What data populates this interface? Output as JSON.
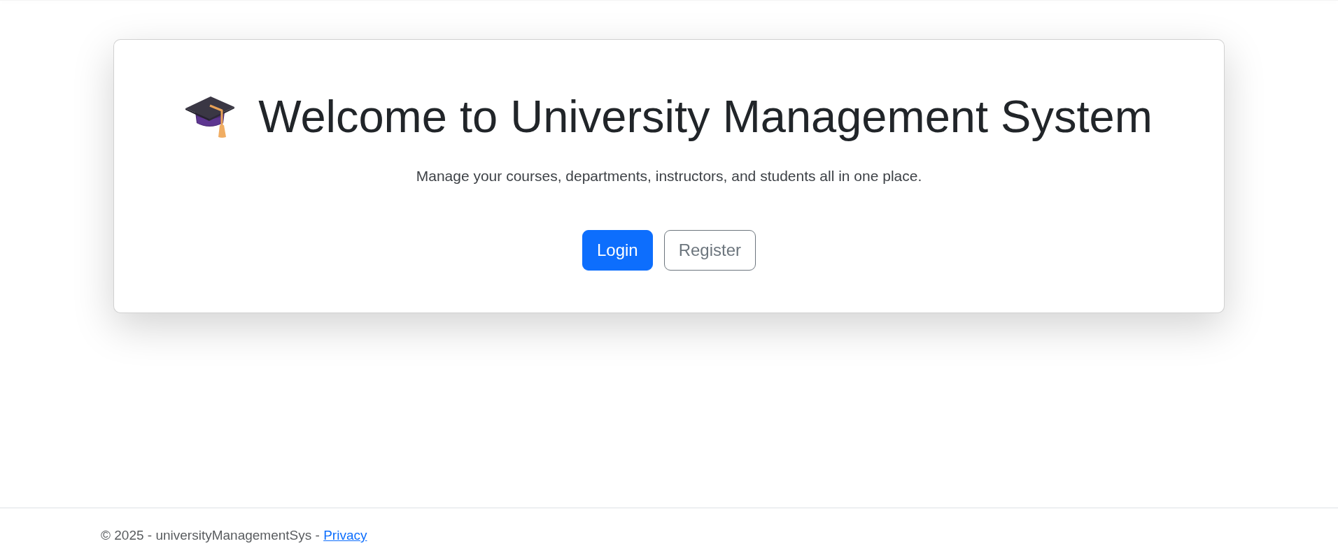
{
  "hero": {
    "title": "Welcome to University Management System",
    "subtitle": "Manage your courses, departments, instructors, and students all in one place.",
    "buttons": [
      {
        "label": "Login",
        "kind": "primary"
      },
      {
        "label": "Register",
        "kind": "outline"
      }
    ]
  },
  "footer": {
    "text": "© 2025 - universityManagementSys -",
    "link": "Privacy"
  }
}
